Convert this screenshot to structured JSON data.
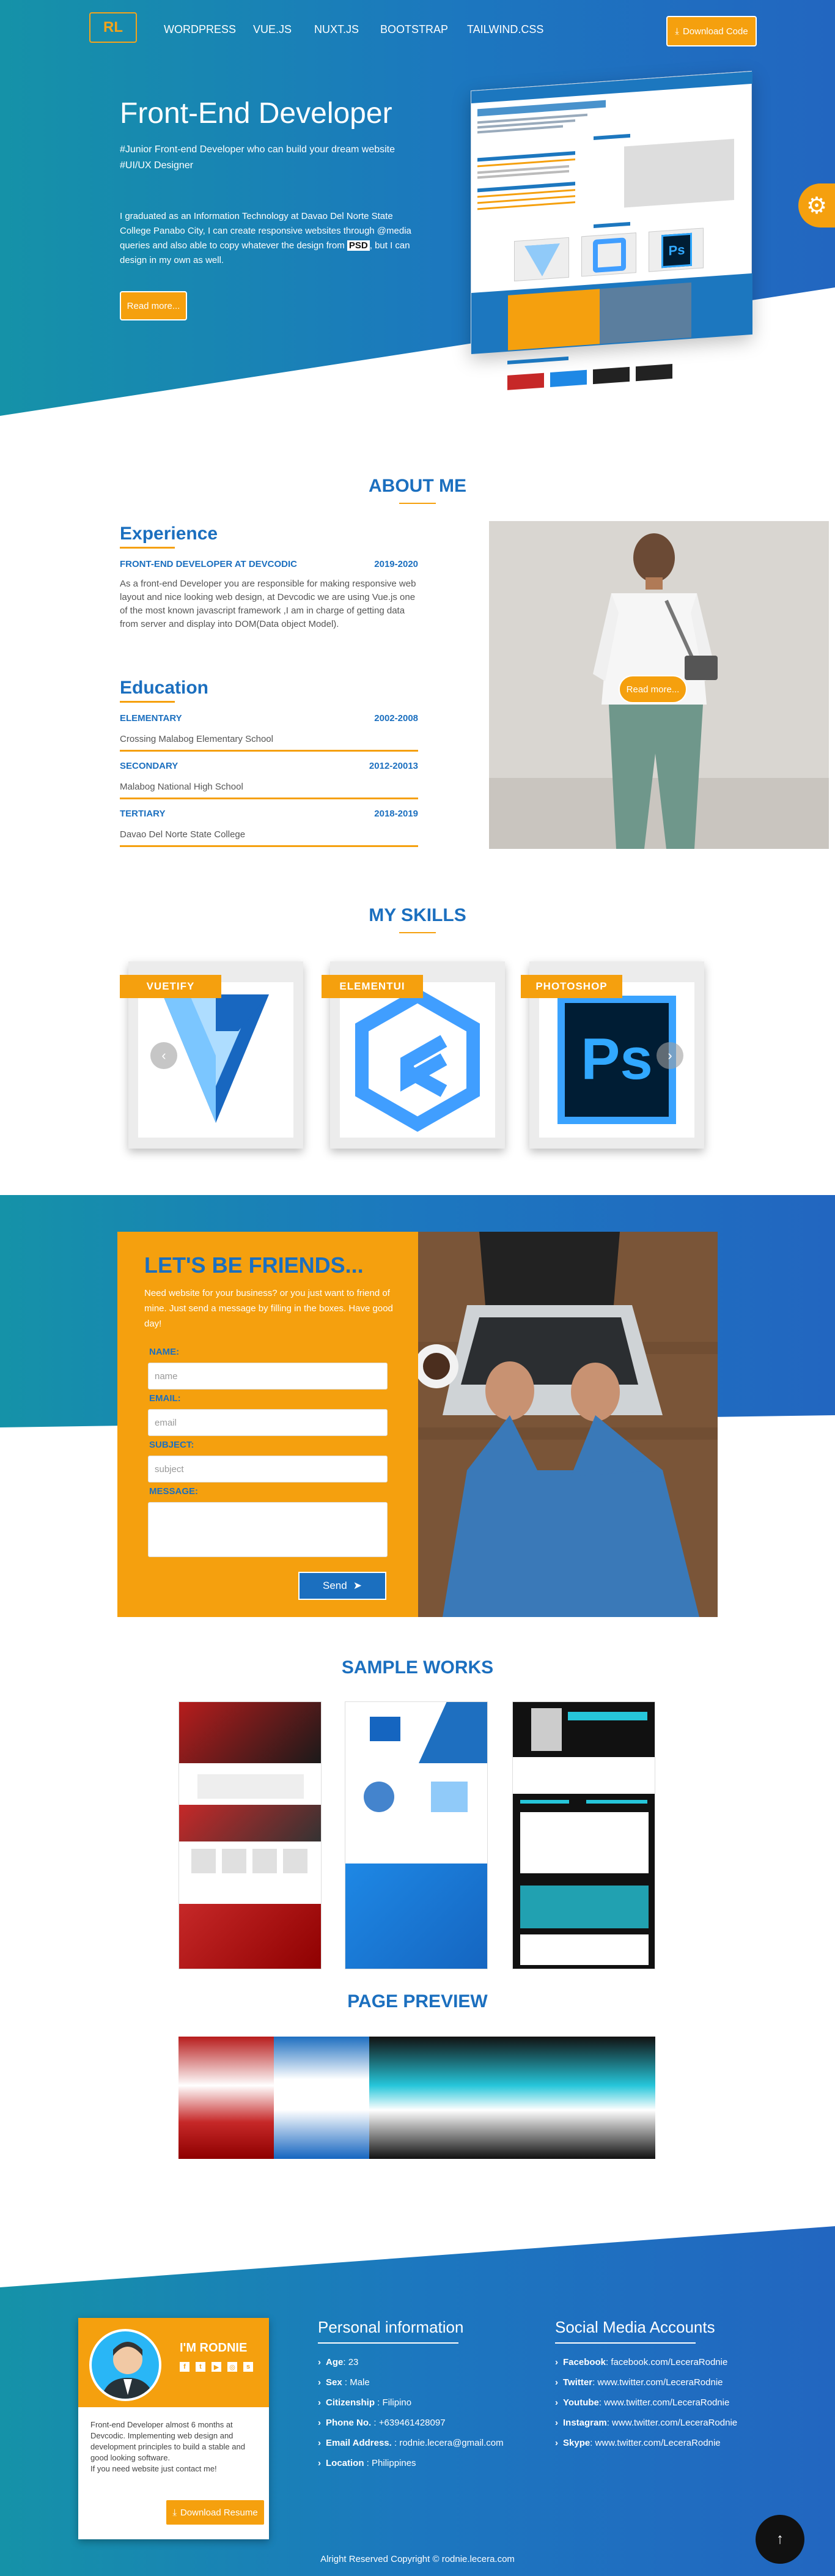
{
  "nav": {
    "logo": "RL",
    "links": [
      "WORDPRESS",
      "VUE.JS",
      "NUXT.JS",
      "BOOTSTRAP",
      "TAILWIND.CSS"
    ],
    "download_label": "Download Code"
  },
  "hero": {
    "title": "Front-End Developer",
    "subtitle_1": "#Junior Front-end Developer who can build your dream website",
    "subtitle_2": "#UI/UX Designer",
    "desc_before": "I graduated as an Information Technology at Davao Del Norte State College Panabo City, I can create responsive websites through @media queries and also able to copy whatever the design from ",
    "desc_bold": "PSD",
    "desc_after": ", but I can design in my own as well.",
    "read_more": "Read more..."
  },
  "about": {
    "title": "ABOUT ME",
    "experience_heading": "Experience",
    "experience": {
      "role": "FRONT-END DEVELOPER AT DEVCODIC",
      "dates": "2019-2020",
      "desc": "As a front-end Developer you are responsible for making responsive web layout and nice looking web design, at Devcodic we are using Vue.js one of the most known javascript framework ,I am in charge of getting data from server and display into DOM(Data object Model)."
    },
    "education_heading": "Education",
    "education": [
      {
        "level": "ELEMENTARY",
        "dates": "2002-2008",
        "school": "Crossing Malabog Elementary School"
      },
      {
        "level": "SECONDARY",
        "dates": "2012-20013",
        "school": "Malabog National High School"
      },
      {
        "level": "TERTIARY",
        "dates": "2018-2019",
        "school": "Davao Del Norte State College"
      }
    ],
    "photo_button": "Read more..."
  },
  "skills": {
    "title": "MY SKILLS",
    "items": [
      {
        "label": "VUETIFY",
        "icon": "vuetify-logo"
      },
      {
        "label": "ELEMENTUI",
        "icon": "elementui-logo"
      },
      {
        "label": "PHOTOSHOP",
        "icon": "photoshop-logo"
      }
    ],
    "prev": "‹",
    "next": "›"
  },
  "contact": {
    "title": "LET'S BE FRIENDS...",
    "intro": "Need website for your business? or you just want to friend of mine. Just send a message by filling in the boxes. Have good day!",
    "name_label": "NAME:",
    "name_placeholder": "name",
    "email_label": "EMAIL:",
    "email_placeholder": "email",
    "subject_label": "SUBJECT:",
    "subject_placeholder": "subject",
    "message_label": "MESSAGE:",
    "send_label": "Send"
  },
  "works": {
    "title": "SAMPLE WORKS",
    "preview_title": "PAGE PREVIEW"
  },
  "footer": {
    "name": "I'M RODNIE",
    "bio": "Front-end Developer almost 6 months at Devcodic. Implementing web design and development principles to build a stable and good looking software.\nIf you need website just contact me!",
    "resume_label": "Download Resume",
    "personal_title": "Personal information",
    "personal": [
      {
        "key": "Age",
        "sep": ": ",
        "value": "23"
      },
      {
        "key": "Sex",
        "sep": " : ",
        "value": "Male"
      },
      {
        "key": "Citizenship",
        "sep": " : ",
        "value": "Filipino"
      },
      {
        "key": "Phone No.",
        "sep": " : ",
        "value": "+639461428097"
      },
      {
        "key": "Email Address.",
        "sep": " : ",
        "value": "rodnie.lecera@gmail.com"
      },
      {
        "key": "Location",
        "sep": " : ",
        "value": "Philippines"
      }
    ],
    "social_title": "Social Media Accounts",
    "social": [
      {
        "key": "Facebook",
        "sep": ": ",
        "value": "facebook.com/LeceraRodnie"
      },
      {
        "key": "Twitter",
        "sep": ": ",
        "value": "www.twitter.com/LeceraRodnie"
      },
      {
        "key": "Youtube",
        "sep": ": ",
        "value": "www.twitter.com/LeceraRodnie"
      },
      {
        "key": "Instagram",
        "sep": ": ",
        "value": "www.twitter.com/LeceraRodnie"
      },
      {
        "key": "Skype",
        "sep": ": ",
        "value": "www.twitter.com/LeceraRodnie"
      }
    ],
    "copyright": "Alright Reserved Copyright © rodnie.lecera.com"
  },
  "colors": {
    "accent": "#f5a00e",
    "brand": "#1b6fbf",
    "teal": "#1592a8"
  }
}
